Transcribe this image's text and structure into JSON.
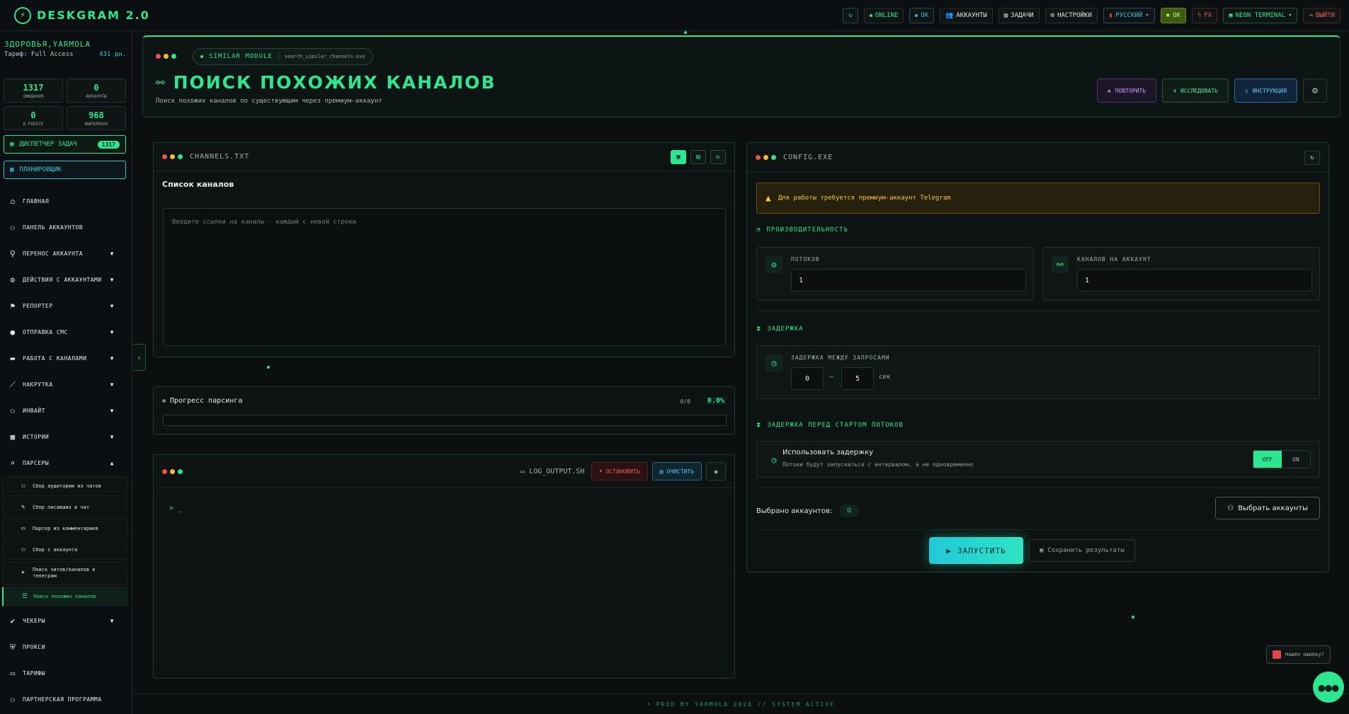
{
  "app": {
    "title": "DESKGRAM 2.0"
  },
  "topbar": {
    "online": "ONLINE",
    "ok": "OK",
    "accounts": "АККАУНТЫ",
    "tasks": "ЗАДАЧИ",
    "settings": "НАСТРОЙКИ",
    "language": "РУССКИЙ",
    "ok2": "OK",
    "fx": "FX",
    "theme": "NEON TERMINAL",
    "logout": "ВЫЙТИ"
  },
  "sidebar": {
    "user": "ЗДОРОВЬЯ,YARMOLA",
    "tariff": "Тариф: Full Access",
    "days": "431 дн.",
    "stats": [
      {
        "num": "1317",
        "label": "ОЖИДАНИЯ"
      },
      {
        "num": "0",
        "label": "АККАУНТЫ"
      },
      {
        "num": "0",
        "label": "В РАБОТЕ"
      },
      {
        "num": "968",
        "label": "ВЫПОЛНЕНО"
      }
    ],
    "dispatcher": "ДИСПЕТЧЕР ЗАДАЧ",
    "dispatcher_count": "1317",
    "scheduler": "ПЛАНИРОВЩИК",
    "items": [
      {
        "label": "ГЛАВНАЯ"
      },
      {
        "label": "ПАНЕЛЬ АККАУНТОВ"
      },
      {
        "label": "ПЕРЕНОС АККАУНТА"
      },
      {
        "label": "ДЕЙСТВИЯ С АККАУНТАМИ"
      },
      {
        "label": "РЕПОРТЕР"
      },
      {
        "label": "ОТПРАВКА СМС"
      },
      {
        "label": "РАБОТА С КАНАЛАМИ"
      },
      {
        "label": "НАКРУТКА"
      },
      {
        "label": "ИНВАЙТ"
      },
      {
        "label": "ИСТОРИИ"
      },
      {
        "label": "ПАРСЕРЫ"
      },
      {
        "label": "ЧЕКЕРЫ"
      },
      {
        "label": "ПРОКСИ"
      },
      {
        "label": "ТАРИФЫ"
      },
      {
        "label": "ПАРТНЕРСКАЯ ПРОГРАММА"
      }
    ],
    "parsers": [
      {
        "label": "Сбор аудитории из чатов"
      },
      {
        "label": "Сбор писавших в чат"
      },
      {
        "label": "Парсер из комментариев"
      },
      {
        "label": "Сбор с аккаунта"
      },
      {
        "label": "Поиск чатов/каналов в телеграм"
      },
      {
        "label": "Поиск похожих каналов"
      }
    ]
  },
  "hero": {
    "module": "SIMILAR MODULE",
    "file": "search_similar_channels.exe",
    "title": "ПОИСК ПОХОЖИХ КАНАЛОВ",
    "subtitle": "Поиск похожих каналов по существующим через премиум-аккаунт",
    "repeat": "ПОВТОРИТЬ",
    "explore": "ИССЛЕДОВАТЬ",
    "manual": "ИНСТРУКЦИЯ"
  },
  "channels": {
    "file": "CHANNELS.TXT",
    "heading": "Список каналов",
    "placeholder": "Введите ссылки на каналы - каждый с новой строки"
  },
  "progress": {
    "label": "Прогресс парсинга",
    "count": "0/0",
    "percent": "0.0%",
    "fraction": 0
  },
  "log": {
    "file": "LOG_OUTPUT.SH",
    "stop": "ОСТАНОВИТЬ",
    "clear": "ОЧИСТИТЬ",
    "prompt": "> _"
  },
  "config": {
    "file": "CONFIG.EXE",
    "warning": "Для работы требуется премиум-аккаунт Telegram",
    "perf_title": "ПРОИЗВОДИТЕЛЬНОСТЬ",
    "threads_label": "ПОТОКОВ",
    "threads_value": "1",
    "per_account_label": "КАНАЛОВ НА АККАУНТ",
    "per_account_value": "1",
    "delay_title": "ЗАДЕРЖКА",
    "delay_label": "ЗАДЕРЖКА МЕЖДУ ЗАПРОСАМИ",
    "delay_min": "0",
    "delay_dash": "—",
    "delay_max": "5",
    "delay_unit": "сек",
    "start_delay_title": "ЗАДЕРЖКА ПЕРЕД СТАРТОМ ПОТОКОВ",
    "use_delay": "Использовать задержку",
    "use_delay_desc": "Потоки будут запускаться с интервалом, а не одновременно",
    "toggle_off": "OFF",
    "toggle_on": "ON",
    "selected_label": "Выбрано аккаунтов:",
    "selected_count": "0",
    "choose_accounts": "Выбрать аккаунты",
    "start": "ЗАПУСТИТЬ",
    "save": "Сохранить результаты"
  },
  "footer": {
    "text": "• PROD BY YARMOLA 2026  // SYSTEM ACTIVE"
  },
  "bug": {
    "label": "Нашёл ошибку?"
  },
  "colors": {
    "accent": "#2ee68f",
    "cyan": "#34c6d9",
    "warning": "#f3c842",
    "danger": "#f05a5a"
  }
}
